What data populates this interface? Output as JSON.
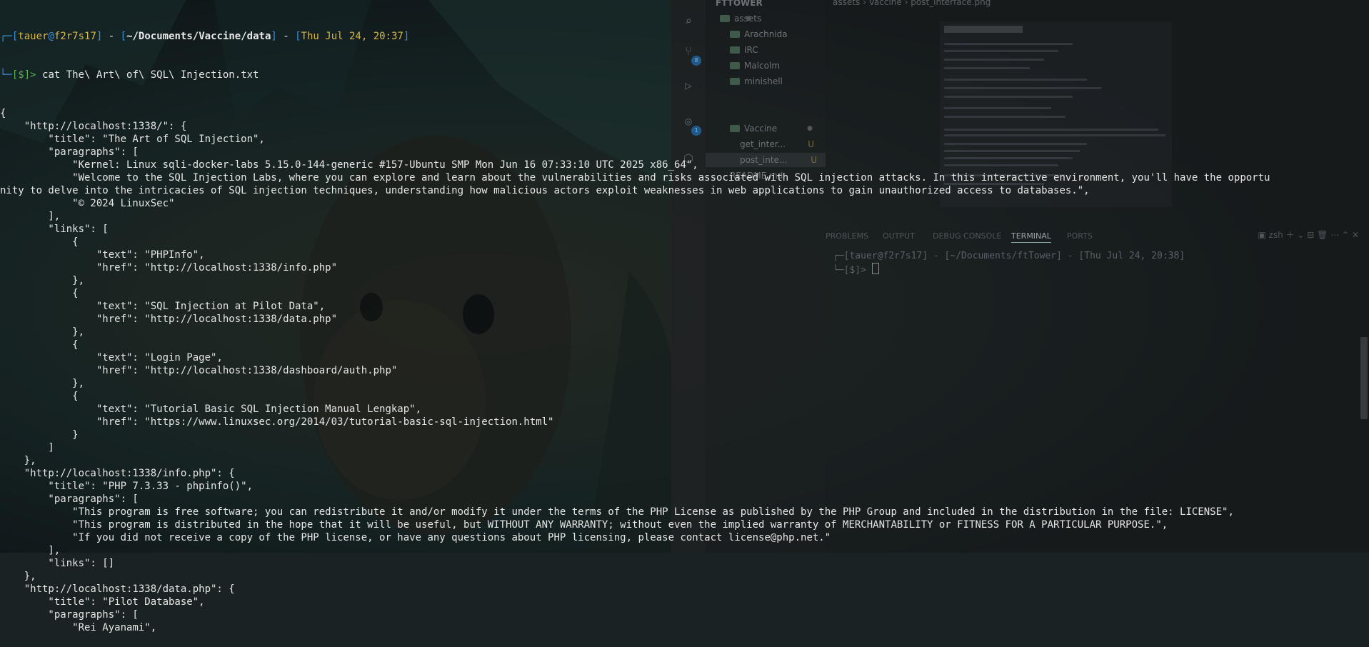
{
  "terminal": {
    "prompt": {
      "user": "tauer",
      "host": "f2r7s17",
      "path": "~/Documents/Vaccine/data",
      "datetime": "Thu Jul 24, 20:37",
      "symbol": "[$]>",
      "command": "cat The\\ Art\\ of\\ SQL\\ Injection.txt"
    },
    "output_lines": [
      "{",
      "    \"http://localhost:1338/\": {",
      "        \"title\": \"The Art of SQL Injection\",",
      "        \"paragraphs\": [",
      "            \"Kernel: Linux sqli-docker-labs 5.15.0-144-generic #157-Ubuntu SMP Mon Jun 16 07:33:10 UTC 2025 x86_64\",",
      "            \"Welcome to the SQL Injection Labs, where you can explore and learn about the vulnerabilities and risks associated with SQL injection attacks. In this interactive environment, you'll have the opportu",
      "nity to delve into the intricacies of SQL injection techniques, understanding how malicious actors exploit weaknesses in web applications to gain unauthorized access to databases.\",",
      "            \"© 2024 LinuxSec\"",
      "        ],",
      "        \"links\": [",
      "            {",
      "                \"text\": \"PHPInfo\",",
      "                \"href\": \"http://localhost:1338/info.php\"",
      "            },",
      "            {",
      "                \"text\": \"SQL Injection at Pilot Data\",",
      "                \"href\": \"http://localhost:1338/data.php\"",
      "            },",
      "            {",
      "                \"text\": \"Login Page\",",
      "                \"href\": \"http://localhost:1338/dashboard/auth.php\"",
      "            },",
      "            {",
      "                \"text\": \"Tutorial Basic SQL Injection Manual Lengkap\",",
      "                \"href\": \"https://www.linuxsec.org/2014/03/tutorial-basic-sql-injection.html\"",
      "            }",
      "        ]",
      "    },",
      "    \"http://localhost:1338/info.php\": {",
      "        \"title\": \"PHP 7.3.33 - phpinfo()\",",
      "        \"paragraphs\": [",
      "            \"This program is free software; you can redistribute it and/or modify it under the terms of the PHP License as published by the PHP Group and included in the distribution in the file: LICENSE\",",
      "            \"This program is distributed in the hope that it will be useful, but WITHOUT ANY WARRANTY; without even the implied warranty of MERCHANTABILITY or FITNESS FOR A PARTICULAR PURPOSE.\",",
      "            \"If you did not receive a copy of the PHP license, or have any questions about PHP licensing, please contact license@php.net.\"",
      "        ],",
      "        \"links\": []",
      "    },",
      "    \"http://localhost:1338/data.php\": {",
      "        \"title\": \"Pilot Database\",",
      "        \"paragraphs\": [",
      "            \"Rei Ayanami\","
    ]
  },
  "vscode": {
    "explorer_root": "FTTOWER",
    "tree": [
      {
        "label": "assets",
        "type": "folder"
      },
      {
        "label": "Arachnida",
        "type": "folder"
      },
      {
        "label": "IRC",
        "type": "folder"
      },
      {
        "label": "Malcolm",
        "type": "folder"
      },
      {
        "label": "minishell",
        "type": "folder"
      },
      {
        "label": "Vaccine",
        "type": "folder"
      },
      {
        "label": "get_inter...",
        "type": "file",
        "status": "U"
      },
      {
        "label": "post_inte...",
        "type": "file",
        "status": "U"
      },
      {
        "label": "README.md",
        "type": "file"
      }
    ],
    "breadcrumb": [
      "assets",
      "Vaccine",
      "post_interface.png"
    ],
    "panel_tabs": [
      "PROBLEMS",
      "OUTPUT",
      "DEBUG CONSOLE",
      "TERMINAL",
      "PORTS"
    ],
    "active_panel_tab": "TERMINAL",
    "shell_label": "zsh",
    "terminal_prompt": {
      "user": "tauer",
      "host": "f2r7s17",
      "path": "~/Documents/ftTower",
      "datetime": "Thu Jul 24, 20:38",
      "symbol": "[$]>"
    },
    "badges": [
      "8",
      "1"
    ]
  },
  "colors": {
    "prompt_box": "#3f8fd6",
    "prompt_user": "#d7b846",
    "prompt_dollar": "#56b04f",
    "text": "#e6e6e6"
  }
}
